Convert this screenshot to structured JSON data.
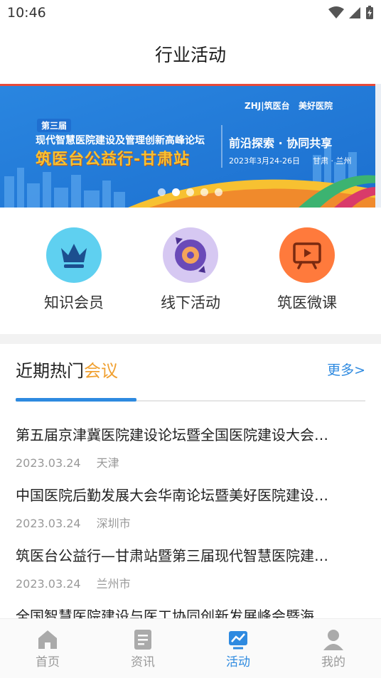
{
  "status_bar": {
    "time": "10:46"
  },
  "header": {
    "title": "行业活动"
  },
  "banner": {
    "edition": "第三届",
    "forum": "现代智慧医院建设及管理创新高峰论坛",
    "main_title": "筑医台公益行-甘肃站",
    "slogan": "前沿探索 · 协同共享",
    "date": "2023年3月24-26日",
    "city": "甘肃 · 兰州",
    "logo1": "ZHJ|筑医台",
    "logo2": "美好医院",
    "dots": 5,
    "active_dot": 1
  },
  "shortcuts": [
    {
      "label": "知识会员",
      "icon": "crown-icon",
      "color": "#5fd0f0"
    },
    {
      "label": "线下活动",
      "icon": "disc-icon",
      "color": "#d6c8f2"
    },
    {
      "label": "筑医微课",
      "icon": "video-screen-icon",
      "color": "#ff7a3c"
    }
  ],
  "section": {
    "title_main": "近期热门",
    "title_accent": "会议",
    "more": "更多>"
  },
  "news": [
    {
      "title": "第五届京津冀医院建设论坛暨全国医院建设大会…",
      "date": "2023.03.24",
      "location": "天津"
    },
    {
      "title": "中国医院后勤发展大会华南论坛暨美好医院建设…",
      "date": "2023.03.24",
      "location": "深圳市"
    },
    {
      "title": "筑医台公益行—甘肃站暨第三届现代智慧医院建…",
      "date": "2023.03.24",
      "location": "兰州市"
    },
    {
      "title": "全国智慧医院建设与医工协同创新发展峰会暨海…",
      "date": "",
      "location": ""
    }
  ],
  "tabbar": [
    {
      "label": "首页",
      "icon": "home-icon"
    },
    {
      "label": "资讯",
      "icon": "document-icon"
    },
    {
      "label": "活动",
      "icon": "activity-chart-icon",
      "active": true
    },
    {
      "label": "我的",
      "icon": "user-icon"
    }
  ],
  "colors": {
    "accent": "#2e8ae0",
    "highlight": "#f0a030"
  }
}
